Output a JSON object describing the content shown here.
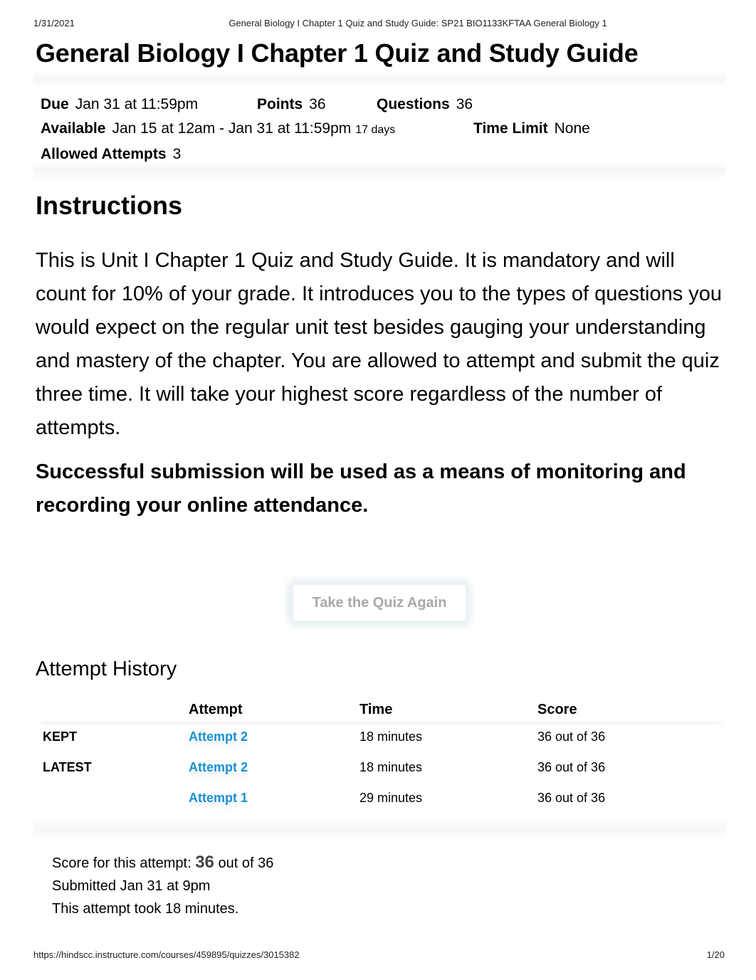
{
  "print_header": {
    "date": "1/31/2021",
    "title": "General Biology I Chapter 1 Quiz and Study Guide: SP21 BIO1133KFTAA General Biology 1"
  },
  "page_title": "General Biology I Chapter 1 Quiz and Study Guide",
  "quiz_details": {
    "due": {
      "label": "Due",
      "value": "Jan 31 at 11:59pm"
    },
    "points": {
      "label": "Points",
      "value": "36"
    },
    "questions": {
      "label": "Questions",
      "value": "36"
    },
    "available": {
      "label": "Available",
      "value": "Jan 15 at 12am - Jan 31 at 11:59pm",
      "duration": "17 days"
    },
    "time_limit": {
      "label": "Time Limit",
      "value": "None"
    },
    "allowed_attempts": {
      "label": "Allowed Attempts",
      "value": "3"
    }
  },
  "instructions": {
    "title": "Instructions",
    "body": "This is Unit I Chapter 1 Quiz and Study Guide. It is mandatory and will count for 10% of your grade. It introduces you to the types of questions you would expect on the regular unit test besides gauging your understanding and mastery of the chapter. You are allowed to attempt and submit the quiz three time. It will take your highest score regardless of the number of attempts.",
    "note": "Successful submission will be used as a means of monitoring and recording your online attendance."
  },
  "take_quiz_again_label": "Take the Quiz Again",
  "attempt_history": {
    "title": "Attempt History",
    "columns": [
      "",
      "Attempt",
      "Time",
      "Score"
    ],
    "rows": [
      {
        "status": "KEPT",
        "attempt": "Attempt 2",
        "time": "18 minutes",
        "score": "36 out of 36"
      },
      {
        "status": "LATEST",
        "attempt": "Attempt 2",
        "time": "18 minutes",
        "score": "36 out of 36"
      },
      {
        "status": "",
        "attempt": "Attempt 1",
        "time": "29 minutes",
        "score": "36 out of 36"
      }
    ]
  },
  "attempt_summary": {
    "score_prefix": "Score for this attempt:",
    "score_value": "36",
    "score_suffix": "out of 36",
    "submitted": "Submitted Jan 31 at 9pm",
    "duration": "This attempt took 18 minutes."
  },
  "print_footer": {
    "url": "https://hindscc.instructure.com/courses/459895/quizzes/3015382",
    "page": "1/20"
  },
  "colors": {
    "link": "#1a8fd6",
    "button_text_disabled": "#a8a8a8"
  }
}
